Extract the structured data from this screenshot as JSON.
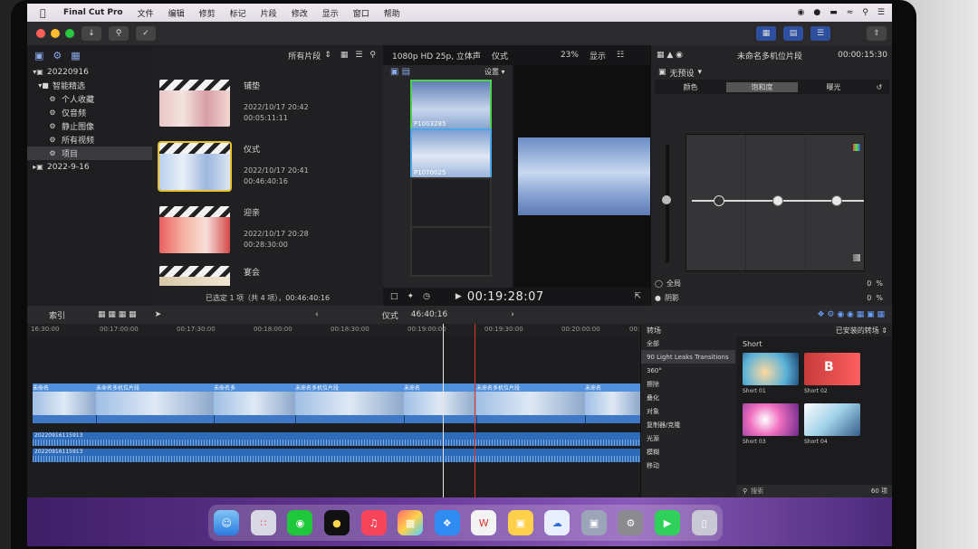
{
  "menubar": {
    "app": "Final Cut Pro",
    "items": [
      "文件",
      "编辑",
      "修剪",
      "标记",
      "片段",
      "修改",
      "显示",
      "窗口",
      "帮助"
    ]
  },
  "library": {
    "items": [
      {
        "label": "20220916",
        "icon": "library-icon",
        "level": 0
      },
      {
        "label": "智能精选",
        "icon": "folder-icon",
        "level": 1
      },
      {
        "label": "个人收藏",
        "icon": "gear-icon",
        "level": 2
      },
      {
        "label": "仅音频",
        "icon": "gear-icon",
        "level": 2
      },
      {
        "label": "静止图像",
        "icon": "gear-icon",
        "level": 2
      },
      {
        "label": "所有视频",
        "icon": "gear-icon",
        "level": 2
      },
      {
        "label": "项目",
        "icon": "gear-icon",
        "level": 2,
        "selected": true
      },
      {
        "label": "2022-9-16",
        "icon": "library-icon",
        "level": 0
      }
    ]
  },
  "browser": {
    "filter": "所有片段",
    "clips": [
      {
        "title": "铺垫",
        "date": "2022/10/17 20:42",
        "duration": "00:05:11:11"
      },
      {
        "title": "仪式",
        "date": "2022/10/17 20:41",
        "duration": "00:46:40:16",
        "selected": true
      },
      {
        "title": "迎亲",
        "date": "2022/10/17 20:28",
        "duration": "00:28:30:00"
      },
      {
        "title": "宴会",
        "date": "",
        "duration": ""
      }
    ],
    "footer": "已选定 1 项（共 4 项），00:46:40:16"
  },
  "viewer": {
    "format": "1080p HD 25p, 立体声",
    "name": "仪式",
    "zoom": "23%",
    "view": "显示",
    "settings": "设置",
    "angles": [
      "P1003285",
      "P1070025"
    ],
    "timecode": "00:19:28:07"
  },
  "inspector": {
    "title": "未命名多机位片段",
    "time": "00:00:15:30",
    "preset": "无预设",
    "tabs": [
      "颜色",
      "饱和度",
      "曝光"
    ],
    "rows": [
      {
        "label": "全局",
        "value": "0",
        "unit": "%"
      },
      {
        "label": "阴影",
        "value": "0",
        "unit": "%"
      }
    ]
  },
  "timeline": {
    "index_label": "索引",
    "name": "仪式",
    "duration": "46:40:16",
    "ruler": [
      "16:30:00",
      "00:17:00:00",
      "00:17:30:00",
      "00:18:00:00",
      "00:18:30:00",
      "00:19:00:00",
      "00:19:30:00",
      "00:20:00:00",
      "00:20:30:00"
    ],
    "segments": [
      "未命名",
      "未命名多机位片段",
      "未命名多",
      "未命名多机位片段",
      "未命名",
      "未命名多机位片段",
      "未命名"
    ],
    "audio_tracks": [
      "20220916115913",
      "20220916115913"
    ]
  },
  "transitions": {
    "header": "转场",
    "installed": "已安装的转场",
    "categories": [
      "全部",
      "90 Light Leaks Transitions",
      "360°",
      "擦除",
      "叠化",
      "对象",
      "复制器/克隆",
      "光源",
      "模糊",
      "移动"
    ],
    "section": "Short",
    "items": [
      "Short 01",
      "Short 02",
      "Short 03",
      "Short 04"
    ],
    "search_placeholder": "搜索",
    "count": "60 项"
  },
  "colors": {
    "accent": "#2e4f9e",
    "selection": "#e8c22c",
    "clip_blue": "#3f78c5",
    "playhead_white": "#e8e8e8",
    "skimmer_red": "#e0352b"
  }
}
